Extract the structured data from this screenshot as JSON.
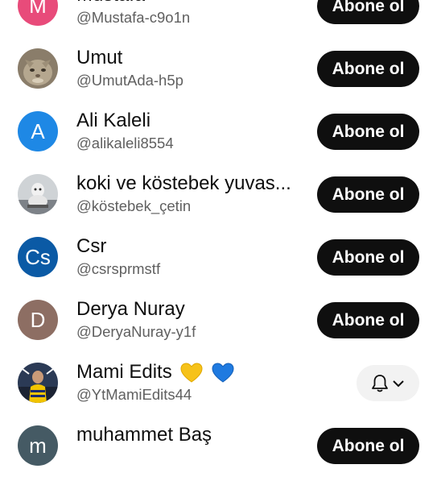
{
  "subscribe_label": "Abone ol",
  "rows": [
    {
      "name": "Mustafa",
      "handle": "@Mustafa-c9o1n",
      "avatar_letter": "M",
      "avatar_color": "#e84b7a"
    },
    {
      "name": "Umut",
      "handle": "@UmutAda-h5p",
      "avatar_icon": "cat-photo-avatar"
    },
    {
      "name": "Ali Kaleli",
      "handle": "@alikaleli8554",
      "avatar_letter": "A",
      "avatar_color": "#1e88e5"
    },
    {
      "name": "koki ve köstebek yuvas...",
      "handle": "@köstebek_çetin",
      "avatar_icon": "photo-avatar"
    },
    {
      "name": "Csr",
      "handle": "@csrsprmstf",
      "avatar_letter": "Cs",
      "avatar_color": "#0b5aa5"
    },
    {
      "name": "Derya Nuray",
      "handle": "@DeryaNuray-y1f",
      "avatar_letter": "D",
      "avatar_color": "#8d6e63"
    },
    {
      "name": "Mami Edits",
      "handle": "@YtMamiEdits44",
      "avatar_icon": "football-player-avatar",
      "subscribed": true
    },
    {
      "name": "muhammet Baş",
      "handle": "",
      "avatar_letter": "m",
      "avatar_color": "#455a64"
    }
  ]
}
